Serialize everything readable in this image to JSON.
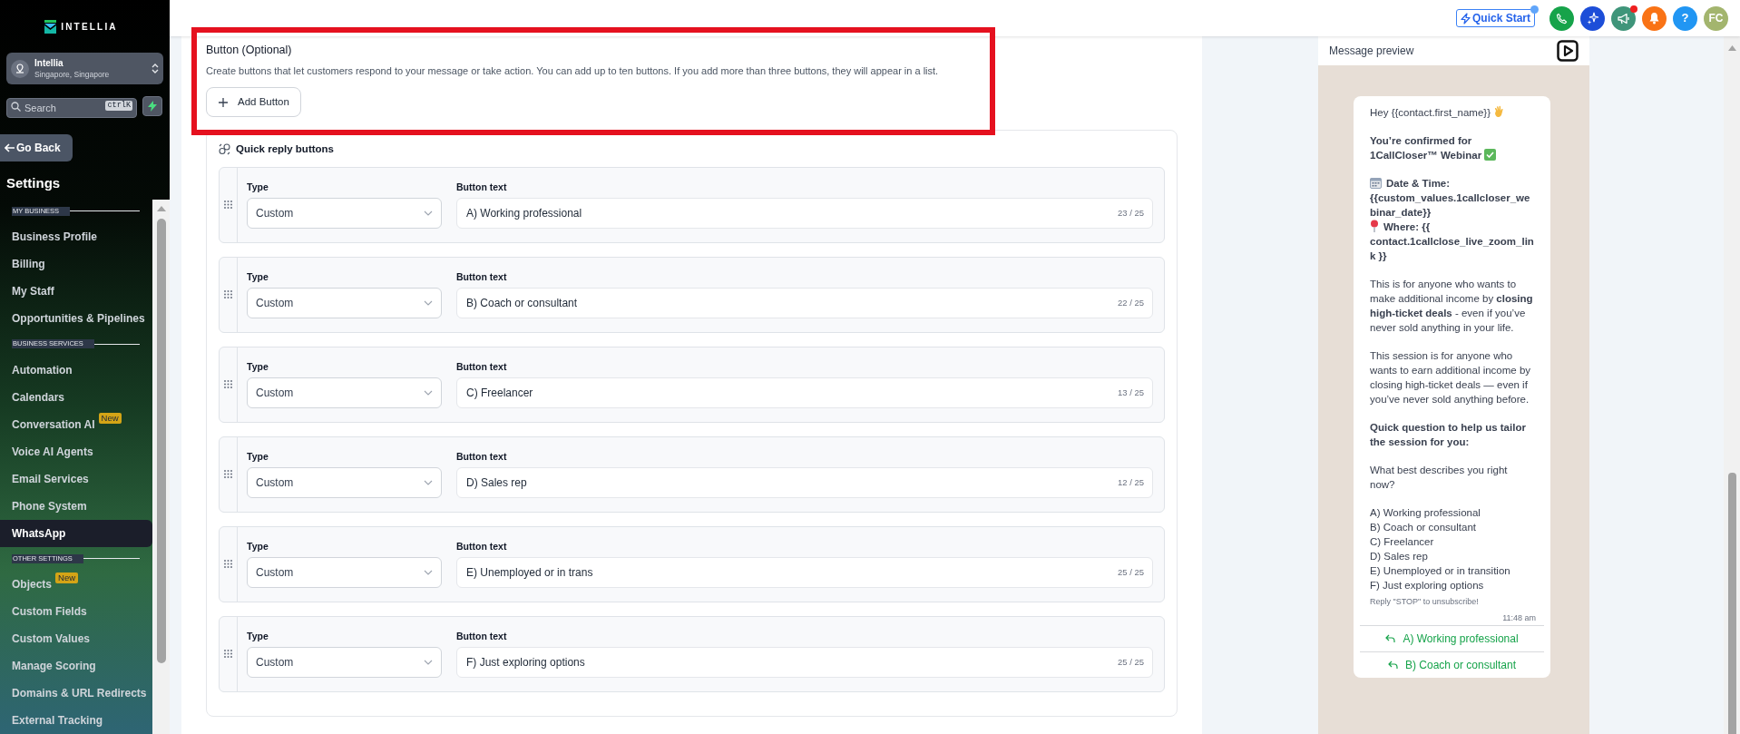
{
  "sidebar": {
    "logo": "INTELLIA",
    "account": {
      "name": "Intellia",
      "location": "Singapore, Singapore"
    },
    "search": {
      "placeholder": "Search",
      "shortcut": "ctrlK"
    },
    "back_button": "Go Back",
    "heading": "Settings",
    "groups": [
      {
        "title": "MY BUSINESS",
        "items": [
          {
            "label": "Business Profile",
            "selected": false
          },
          {
            "label": "Billing",
            "selected": false
          },
          {
            "label": "My Staff",
            "selected": false
          },
          {
            "label": "Opportunities & Pipelines",
            "selected": false
          }
        ]
      },
      {
        "title": "BUSINESS SERVICES",
        "items": [
          {
            "label": "Automation",
            "selected": false
          },
          {
            "label": "Calendars",
            "selected": false
          },
          {
            "label": "Conversation AI",
            "badge": "New",
            "selected": false
          },
          {
            "label": "Voice AI Agents",
            "selected": false
          },
          {
            "label": "Email Services",
            "selected": false
          },
          {
            "label": "Phone System",
            "selected": false
          },
          {
            "label": "WhatsApp",
            "selected": true
          }
        ]
      },
      {
        "title": "OTHER SETTINGS",
        "items": [
          {
            "label": "Objects",
            "badge": "New",
            "selected": false
          },
          {
            "label": "Custom Fields",
            "selected": false
          },
          {
            "label": "Custom Values",
            "selected": false
          },
          {
            "label": "Manage Scoring",
            "selected": false
          },
          {
            "label": "Domains & URL Redirects",
            "selected": false
          },
          {
            "label": "External Tracking",
            "selected": false
          }
        ]
      }
    ]
  },
  "topbar": {
    "quick_start": {
      "label": "Quick Start",
      "dot": true
    },
    "actions": [
      {
        "kind": "phone",
        "color": "#16a34a",
        "dot": false
      },
      {
        "kind": "sparkle",
        "color": "#1d4ed8",
        "dot": false
      },
      {
        "kind": "megaphone",
        "color": "#3f957a",
        "dot": true
      },
      {
        "kind": "bell",
        "color": "#f97316",
        "dot": false
      },
      {
        "kind": "help",
        "label": "?",
        "color": "#2196f3",
        "dot": false
      },
      {
        "kind": "avatar",
        "label": "FC",
        "color": "#a3b56e",
        "dot": false
      }
    ]
  },
  "button_section": {
    "title": "Button (Optional)",
    "description": "Create buttons that let customers respond to your message or take action. You can add up to ten buttons. If you add more than three buttons, they will appear in a list.",
    "add_button": "Add Button"
  },
  "quick_replies": {
    "title": "Quick reply buttons",
    "rows": [
      {
        "type_label": "Type",
        "type": "Custom",
        "text_label": "Button text",
        "text": "A) Working professional",
        "count": "23 / 25"
      },
      {
        "type_label": "Type",
        "type": "Custom",
        "text_label": "Button text",
        "text": "B) Coach or consultant",
        "count": "22 / 25"
      },
      {
        "type_label": "Type",
        "type": "Custom",
        "text_label": "Button text",
        "text": "C) Freelancer",
        "count": "13 / 25"
      },
      {
        "type_label": "Type",
        "type": "Custom",
        "text_label": "Button text",
        "text": "D) Sales rep",
        "count": "12 / 25"
      },
      {
        "type_label": "Type",
        "type": "Custom",
        "text_label": "Button text",
        "text": "E) Unemployed or in trans",
        "count": "25 / 25"
      },
      {
        "type_label": "Type",
        "type": "Custom",
        "text_label": "Button text",
        "text": "F) Just exploring options",
        "count": "25 / 25"
      }
    ]
  },
  "preview": {
    "title": "Message preview",
    "blocks": [
      {
        "kind": "text",
        "lines": [
          {
            "kind": "wave",
            "text": "Hey {{contact.first_name}}"
          }
        ]
      },
      {
        "kind": "bold",
        "lines": [
          {
            "kind": "check",
            "text": "You’re confirmed for 1CallCloser™ Webinar"
          }
        ]
      },
      {
        "kind": "bold",
        "lines": [
          {
            "kind": "calendar",
            "text": "Date & Time:"
          },
          {
            "kind": "plain",
            "text": "{{custom_values.1callcloser_webinar_date}}"
          },
          {
            "kind": "pin",
            "text": "Where: {{ contact.1callclose_live_zoom_link }}"
          }
        ]
      },
      {
        "kind": "text",
        "lines": [
          {
            "text": "This is for anyone who wants to make additional income by **closing high-ticket deals** - even if you’ve never sold anything in your life."
          }
        ]
      },
      {
        "kind": "text",
        "lines": [
          {
            "text": "This session is for anyone who wants to earn additional income by closing high-ticket deals — even if you’ve never sold anything before."
          }
        ]
      },
      {
        "kind": "bold",
        "lines": [
          {
            "text": "Quick question to help us tailor the session for you:"
          }
        ]
      },
      {
        "kind": "text",
        "lines": [
          {
            "text": "What best describes you right now?"
          }
        ]
      },
      {
        "kind": "text",
        "lines": [
          {
            "text": "A) Working professional"
          },
          {
            "text": "B) Coach or consultant"
          },
          {
            "text": "C) Freelancer"
          },
          {
            "text": "D) Sales rep"
          },
          {
            "text": "E) Unemployed or in transition"
          },
          {
            "text": "F) Just exploring options"
          }
        ]
      }
    ],
    "footer": "Reply \"STOP\" to unsubscribe!",
    "time": "11:48 am",
    "buttons": [
      "A) Working professional",
      "B) Coach or consultant"
    ]
  }
}
